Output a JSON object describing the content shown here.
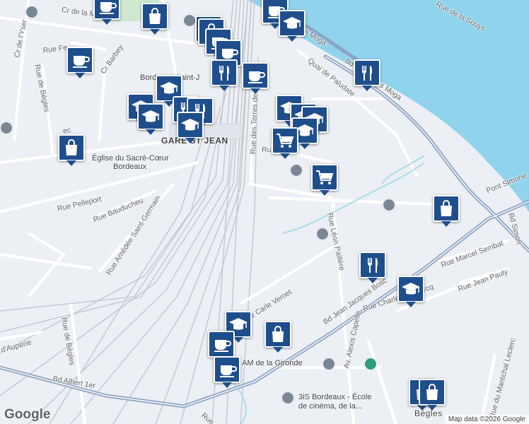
{
  "map": {
    "attribution": "Map data ©2026 Google",
    "logo_text": "Google",
    "colors": {
      "water": "#8fd3ec",
      "road": "#ffffff",
      "arterial": "#8da4c4",
      "rail": "#b8bec8",
      "land": "#eceff3",
      "pin": "#1f4e8c"
    }
  },
  "labels": {
    "cr_de_la_marne": "Cr de la Marne",
    "cr_de_lyser": "Cr de l'Yser",
    "rue_fe": "Rue Fe",
    "cr_barbey": "Cr Barbey",
    "rue_de_begles_n": "Rue de Bègles",
    "rue_de_begles_s": "Rue de Bègles",
    "gare": "GARE ST JEAN",
    "bordeaux_st_j": "Bordeaux Saint-J",
    "eglise_1": "Église du Sacré-Cœur",
    "eglise_2": "Bordeaux",
    "rue_pelleport": "Rue Pelleport",
    "rue_bauducheu": "Rue Bauducheu",
    "rue_amedee": "Rue Amédée Saint-Germain",
    "rue_terres": "Rue des Terres de",
    "rue_r": "Ru",
    "quai_paludate": "Quai de Paludate",
    "quai_moga_1": "Quai Moga",
    "quai_moga_2": "Bd des Frères Moga",
    "rue_souys": "Rue de la Souys",
    "pont_simone": "Pont Simone",
    "bd_simon": "Bd Simon",
    "rue_leon": "Rue Léon Paillère",
    "bd_jj_bosc": "Bd Jean Jacques Bosc",
    "rue_marcel": "Rue Marcel Sembat",
    "rue_pauly": "Rue Jean Pauly",
    "rue_charles": "Rue Charles Domercq",
    "rue_vernet": "Rue Carle Vernet",
    "av_capelle": "Av. Alexis Capelle",
    "marechal": "Rue du Maréchal Leclerc",
    "bd_albert": "Bd Albert 1er",
    "aupere": "d'Aupérie",
    "am_gironde": "AM de la Gironde",
    "3is_1": "3iS Bordeaux - École",
    "3is_2": "de cinéma, de la...",
    "begles": "Bègles",
    "rue_bottom": "Rue",
    "rec": "ec"
  },
  "pins": [
    {
      "type": "coffee"
    },
    {
      "type": "shopping"
    },
    {
      "type": "coffee"
    },
    {
      "type": "education"
    },
    {
      "type": "education"
    },
    {
      "type": "shopping"
    },
    {
      "type": "coffee"
    },
    {
      "type": "coffee"
    },
    {
      "type": "restaurant"
    },
    {
      "type": "coffee"
    },
    {
      "type": "restaurant"
    },
    {
      "type": "education"
    },
    {
      "type": "restaurant"
    },
    {
      "type": "education"
    },
    {
      "type": "education"
    },
    {
      "type": "education"
    },
    {
      "type": "restaurant"
    },
    {
      "type": "education"
    },
    {
      "type": "shopping"
    },
    {
      "type": "coffee"
    },
    {
      "type": "education"
    },
    {
      "type": "education"
    },
    {
      "type": "education"
    },
    {
      "type": "cart"
    },
    {
      "type": "cart"
    },
    {
      "type": "shopping"
    },
    {
      "type": "restaurant"
    },
    {
      "type": "education"
    },
    {
      "type": "education"
    },
    {
      "type": "coffee"
    },
    {
      "type": "shopping"
    },
    {
      "type": "coffee"
    },
    {
      "type": "shopping"
    },
    {
      "type": "shopping"
    }
  ]
}
